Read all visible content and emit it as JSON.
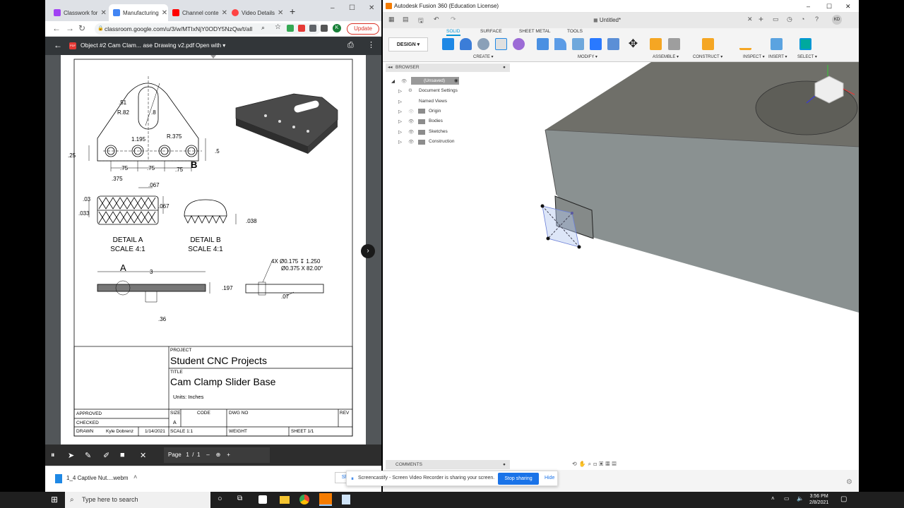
{
  "chrome": {
    "tabs": [
      {
        "label": "Classwork for",
        "color": "#a142f4"
      },
      {
        "label": "Manufacturing",
        "color": "#4285f4"
      },
      {
        "label": "Channel conte",
        "color": "#ff0000"
      },
      {
        "label": "Video Details",
        "color": "#ff4444"
      }
    ],
    "new_tab": "+",
    "window_controls": {
      "minimize": "–",
      "maximize": "☐",
      "close": "✕"
    },
    "url": "classroom.google.com/u/3/w/MTIxNjY0ODY5NzQw/t/all",
    "profile_initial": "K",
    "update_label": "Update"
  },
  "pdf": {
    "filename": "Object #2 Cam Clam... ase Drawing v2.pdf",
    "open_with": "Open with",
    "controls": {
      "page_label": "Page",
      "page_current": "1",
      "page_sep": "/",
      "page_total": "1",
      "zoom_out": "–",
      "zoom_in": "+"
    },
    "drawing": {
      "dims": {
        "d51": ".51",
        "r82": "R.82",
        "d8": ".8",
        "r375": "R.375",
        "d1195": "1.195",
        "d25": ".25",
        "d5": ".5",
        "d75a": ".75",
        "d75b": ".75",
        "d75c": ".75",
        "d375": ".375",
        "d067a": ".067",
        "d03": ".03",
        "d033": ".033",
        "d067b": ".067",
        "d038": ".038",
        "d3": "3",
        "d197": ".197",
        "d36": ".36",
        "d07": ".07",
        "hole1": "4X Ø0.175 ↧ 1.250",
        "hole2": "Ø0.375 X 82.00°"
      },
      "detail_a": "DETAIL A",
      "detail_a_scale": "SCALE 4:1",
      "detail_b": "DETAIL B",
      "detail_b_scale": "SCALE 4:1",
      "label_a": "A",
      "label_b": "B"
    },
    "title_block": {
      "project_label": "PROJECT",
      "project": "Student CNC Projects",
      "title_label": "TITLE",
      "title": "Cam Clamp Slider Base",
      "units": "Units: Inches",
      "approved": "APPROVED",
      "checked": "CHECKED",
      "drawn": "DRAWN",
      "drawn_by": "Kyle Dobrenz",
      "date": "1/14/2021",
      "size_label": "SIZE",
      "size": "A",
      "code": "CODE",
      "dwg_no": "DWG NO",
      "rev": "REV",
      "scale": "SCALE 1:1",
      "weight": "WEIGHT",
      "sheet": "SHEET 1/1"
    }
  },
  "download": {
    "filename": "1_4 Captive Nut....webm",
    "share_btn": "Sh"
  },
  "fusion": {
    "title": "Autodesk Fusion 360 (Education License)",
    "doc_title": "Untitled*",
    "user_initials": "KD",
    "design_btn": "DESIGN",
    "tabs": [
      "SOLID",
      "SURFACE",
      "SHEET METAL",
      "TOOLS"
    ],
    "groups": [
      "CREATE ▾",
      "MODIFY ▾",
      "ASSEMBLE ▾",
      "CONSTRUCT ▾",
      "INSPECT ▾",
      "INSERT ▾",
      "SELECT ▾"
    ],
    "browser": {
      "header": "BROWSER",
      "root": "(Unsaved)",
      "items": [
        "Document Settings",
        "Named Views",
        "Origin",
        "Bodies",
        "Sketches",
        "Construction"
      ]
    },
    "comments": "COMMENTS"
  },
  "screencastify": {
    "message": "Screencastify - Screen Video Recorder is sharing your screen.",
    "stop": "Stop sharing",
    "hide": "Hide"
  },
  "taskbar": {
    "search_placeholder": "Type here to search",
    "time": "3:56 PM",
    "date": "2/8/2021"
  }
}
